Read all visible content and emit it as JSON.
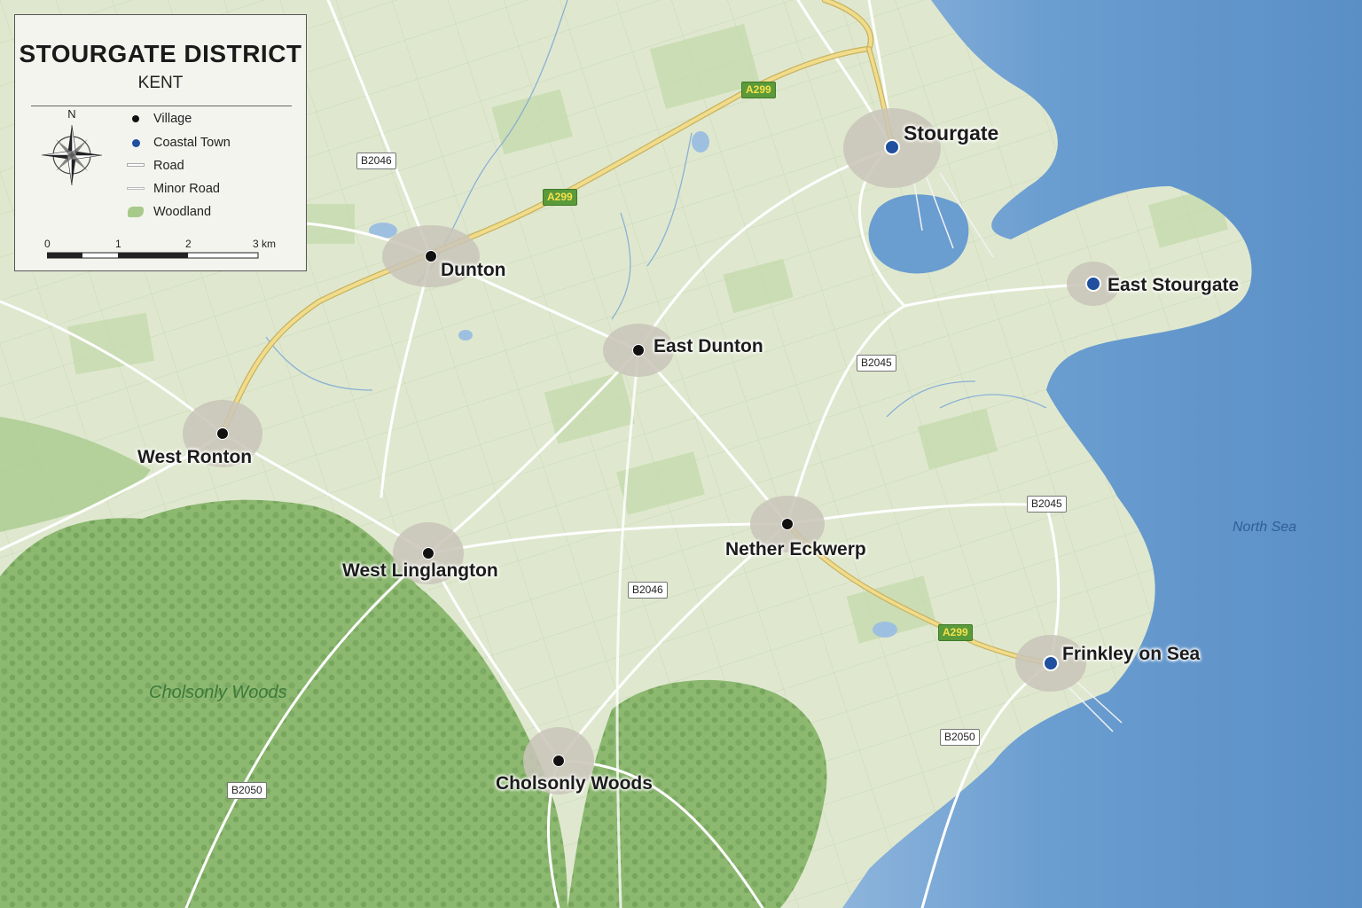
{
  "legend": {
    "title": "STOURGATE DISTRICT",
    "subtitle": "KENT",
    "north": "N",
    "items": [
      {
        "label": "Village",
        "symbol": "village-dot-icon"
      },
      {
        "label": "Coastal Town",
        "symbol": "coastal-town-dot-icon"
      },
      {
        "label": "Road",
        "symbol": "road-line-icon"
      },
      {
        "label": "Minor Road",
        "symbol": "minor-road-line-icon"
      },
      {
        "label": "Woodland",
        "symbol": "woodland-patch-icon"
      }
    ],
    "scale": [
      "0",
      "1",
      "2",
      "3 km"
    ]
  },
  "places": [
    {
      "name": "Stourgate",
      "kind": "coastal"
    },
    {
      "name": "East Stourgate",
      "kind": "coastal"
    },
    {
      "name": "Dunton",
      "kind": "village"
    },
    {
      "name": "East Dunton",
      "kind": "village"
    },
    {
      "name": "West Ronton",
      "kind": "village"
    },
    {
      "name": "West Linglangton",
      "kind": "village"
    },
    {
      "name": "Nether Eckwerp",
      "kind": "village"
    },
    {
      "name": "Frinkley on Sea",
      "kind": "coastal"
    },
    {
      "name": "Cholsonly Woods",
      "kind": "village"
    }
  ],
  "road_labels": [
    "A299",
    "A299",
    "A299",
    "B2046",
    "B2046",
    "B2045",
    "B2045",
    "B2050",
    "B2050"
  ],
  "area_labels": {
    "sea": "North Sea",
    "woods": "Cholsonly Woods"
  },
  "colors": {
    "sea": "#6f9fcf",
    "land": "#dfe8cf",
    "woodland": "#86b46a",
    "a_road": "#ecd68a",
    "coastal_dot": "#1f4f9e",
    "village_dot": "#111111"
  }
}
